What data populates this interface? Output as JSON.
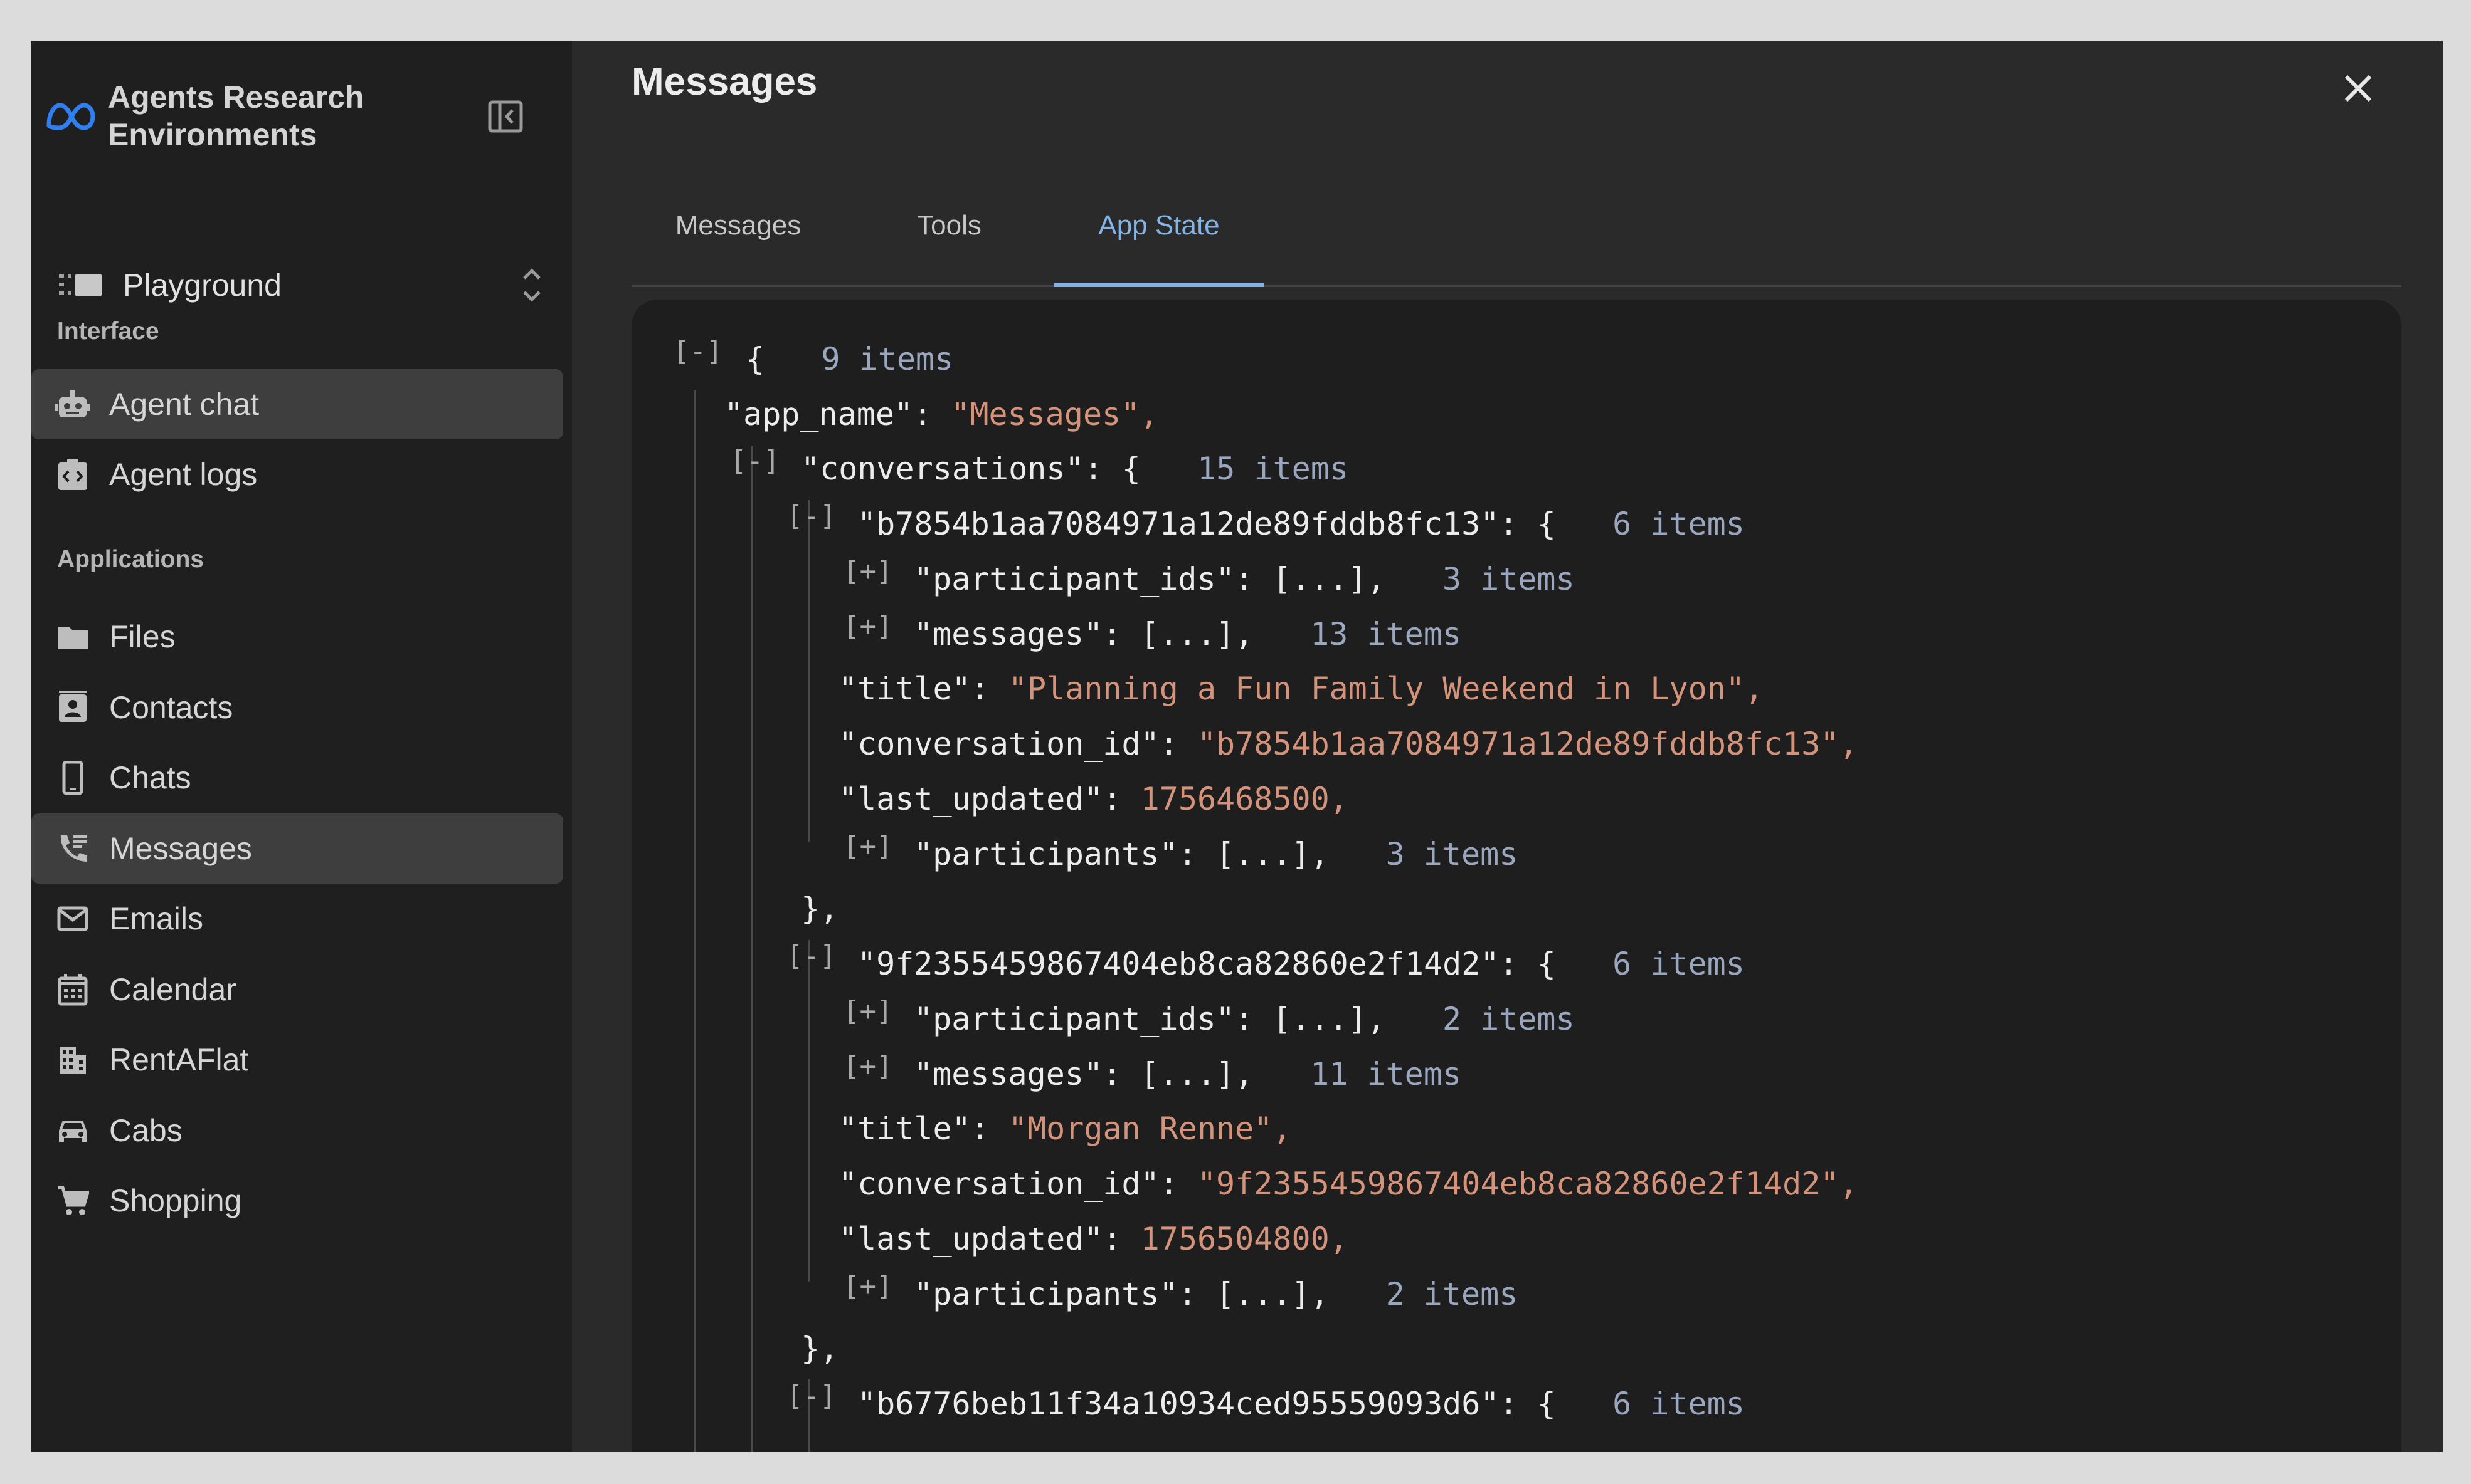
{
  "brand": {
    "line1": "Agents Research",
    "line2": "Environments"
  },
  "workspace": {
    "label": "Playground"
  },
  "sidebar": {
    "section_interface": "Interface",
    "section_applications": "Applications",
    "interface_items": [
      {
        "label": "Agent chat",
        "icon": "robot-icon"
      },
      {
        "label": "Agent logs",
        "icon": "code-log-icon"
      }
    ],
    "app_items": [
      {
        "label": "Files",
        "icon": "folder-icon"
      },
      {
        "label": "Contacts",
        "icon": "contact-card-icon"
      },
      {
        "label": "Chats",
        "icon": "phone-icon"
      },
      {
        "label": "Messages",
        "icon": "phone-message-icon"
      },
      {
        "label": "Emails",
        "icon": "envelope-icon"
      },
      {
        "label": "Calendar",
        "icon": "calendar-icon"
      },
      {
        "label": "RentAFlat",
        "icon": "building-icon"
      },
      {
        "label": "Cabs",
        "icon": "taxi-icon"
      },
      {
        "label": "Shopping",
        "icon": "cart-icon"
      }
    ],
    "active_item": "Messages"
  },
  "modal": {
    "title": "Messages",
    "tabs": [
      {
        "label": "Messages"
      },
      {
        "label": "Tools"
      },
      {
        "label": "App State"
      }
    ],
    "active_tab": "App State"
  },
  "json_tree": {
    "collapse_label": "[-]",
    "expand_label": "[+]",
    "root_open": "{",
    "root_count": "9 items",
    "app_name_key": "\"app_name\": ",
    "app_name_val": "\"Messages\",",
    "conversations_key": "\"conversations\": {",
    "conversations_count": "15 items",
    "conversations": [
      {
        "key": "\"b7854b1aa7084971a12de89fddb8fc13\": {",
        "count": "6 items",
        "participant_ids": "\"participant_ids\": [...],",
        "participant_ids_count": "3 items",
        "messages": "\"messages\": [...],",
        "messages_count": "13 items",
        "title_key": "\"title\": ",
        "title_val": "\"Planning a Fun Family Weekend in Lyon\",",
        "conv_id_key": "\"conversation_id\": ",
        "conv_id_val": "\"b7854b1aa7084971a12de89fddb8fc13\",",
        "last_updated_key": "\"last_updated\": ",
        "last_updated_val": "1756468500,",
        "participants": "\"participants\": [...],",
        "participants_count": "3 items",
        "close": "},"
      },
      {
        "key": "\"9f2355459867404eb8ca82860e2f14d2\": {",
        "count": "6 items",
        "participant_ids": "\"participant_ids\": [...],",
        "participant_ids_count": "2 items",
        "messages": "\"messages\": [...],",
        "messages_count": "11 items",
        "title_key": "\"title\": ",
        "title_val": "\"Morgan Renne\",",
        "conv_id_key": "\"conversation_id\": ",
        "conv_id_val": "\"9f2355459867404eb8ca82860e2f14d2\",",
        "last_updated_key": "\"last_updated\": ",
        "last_updated_val": "1756504800,",
        "participants": "\"participants\": [...],",
        "participants_count": "2 items",
        "close": "},"
      },
      {
        "key": "\"b6776beb11f34a10934ced95559093d6\": {",
        "count": "6 items"
      }
    ]
  },
  "colors": {
    "accent": "#84b4e6",
    "string_value": "#d4937a",
    "count": "#9aa7bf",
    "sidebar_bg": "#1f1f1f",
    "panel_bg": "#1e1e1e"
  }
}
